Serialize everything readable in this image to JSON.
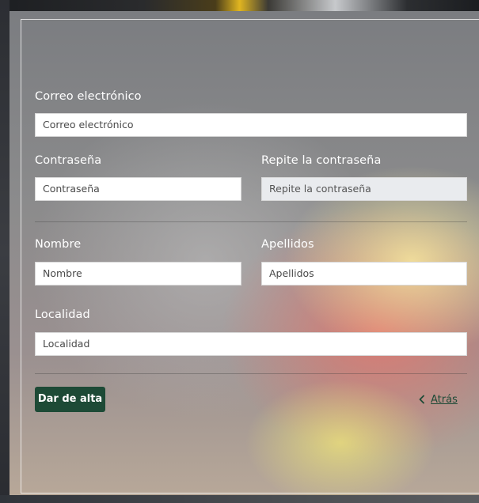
{
  "form": {
    "email": {
      "label": "Correo electrónico",
      "placeholder": "Correo electrónico"
    },
    "password": {
      "label": "Contraseña",
      "placeholder": "Contraseña"
    },
    "password_repeat": {
      "label": "Repite la contraseña",
      "placeholder": "Repite la contraseña"
    },
    "first_name": {
      "label": "Nombre",
      "placeholder": "Nombre"
    },
    "last_name": {
      "label": "Apellidos",
      "placeholder": "Apellidos"
    },
    "locality": {
      "label": "Localidad",
      "placeholder": "Localidad"
    }
  },
  "actions": {
    "submit_label": "Dar de alta",
    "back_label": "Atrás",
    "back_icon": "chevron-left-icon"
  },
  "colors": {
    "primary": "#1d4a36",
    "label_text": "#ffffff"
  }
}
